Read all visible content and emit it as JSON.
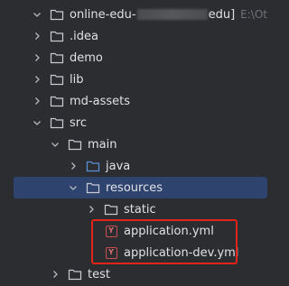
{
  "colors": {
    "background": "#2b2d30",
    "selection": "#2e436e",
    "text": "#dfe1e5",
    "muted": "#6f737a",
    "folder_outline": "#c9ccd1",
    "source_folder": "#5a8fd6",
    "yml_icon": "#c94f4f",
    "highlight": "#e0231b"
  },
  "project": {
    "name_prefix": "online-edu-",
    "name_suffix": "edu]",
    "path_hint": "E:\\Ot"
  },
  "tree": [
    {
      "label": ".idea",
      "icon": "folder-icon",
      "expandable": true,
      "expanded": false
    },
    {
      "label": "demo",
      "icon": "folder-icon",
      "expandable": true,
      "expanded": false
    },
    {
      "label": "lib",
      "icon": "folder-icon",
      "expandable": true,
      "expanded": false
    },
    {
      "label": "md-assets",
      "icon": "folder-icon",
      "expandable": true,
      "expanded": false
    },
    {
      "label": "src",
      "icon": "folder-icon",
      "expandable": true,
      "expanded": true
    },
    {
      "label": "main",
      "icon": "folder-icon",
      "expandable": true,
      "expanded": true
    },
    {
      "label": "java",
      "icon": "source-folder-icon",
      "expandable": true,
      "expanded": false
    },
    {
      "label": "resources",
      "icon": "folder-icon",
      "expandable": true,
      "expanded": true,
      "selected": true
    },
    {
      "label": "static",
      "icon": "folder-icon",
      "expandable": true,
      "expanded": false
    },
    {
      "label": "application.yml",
      "icon": "yml-file-icon",
      "expandable": false
    },
    {
      "label": "application-dev.yml",
      "icon": "yml-file-icon",
      "expandable": false
    },
    {
      "label": "test",
      "icon": "folder-icon",
      "expandable": true,
      "expanded": false
    }
  ],
  "yml_badge_letter": "Y"
}
